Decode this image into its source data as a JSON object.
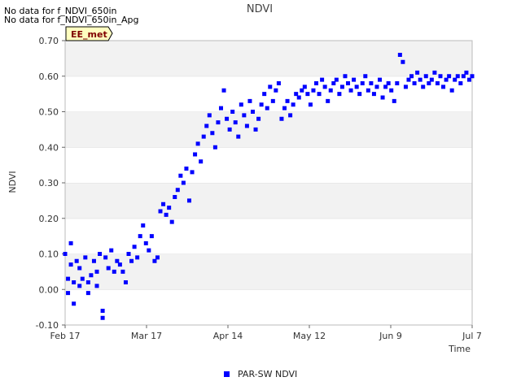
{
  "notices": [
    "No data for f_NDVI_650in",
    "No data for f_NDVI_650in_Apg"
  ],
  "site_badge": "EE_met",
  "chart_data": {
    "type": "scatter",
    "title": "NDVI",
    "xlabel": "Time",
    "ylabel": "NDVI",
    "ylim": [
      -0.1,
      0.7
    ],
    "yticks": [
      "-0.10",
      "0.00",
      "0.10",
      "0.20",
      "0.30",
      "0.40",
      "0.50",
      "0.60",
      "0.70"
    ],
    "xlim": [
      "2024-02-17",
      "2024-07-07"
    ],
    "xticks": [
      "Feb 17",
      "Mar 17",
      "Apr 14",
      "May 12",
      "Jun 9",
      "Jul 7"
    ],
    "grid": "horizontal bands",
    "legend": "bottom-center",
    "series": [
      {
        "name": "PAR-SW NDVI",
        "color": "#0000ff",
        "points": [
          [
            "2024-02-17",
            0.1
          ],
          [
            "2024-02-18",
            0.03
          ],
          [
            "2024-02-18",
            -0.01
          ],
          [
            "2024-02-19",
            0.13
          ],
          [
            "2024-02-19",
            0.07
          ],
          [
            "2024-02-20",
            0.02
          ],
          [
            "2024-02-20",
            -0.04
          ],
          [
            "2024-02-21",
            0.08
          ],
          [
            "2024-02-22",
            0.01
          ],
          [
            "2024-02-22",
            0.06
          ],
          [
            "2024-02-23",
            0.03
          ],
          [
            "2024-02-24",
            0.09
          ],
          [
            "2024-02-25",
            0.02
          ],
          [
            "2024-02-25",
            -0.01
          ],
          [
            "2024-02-26",
            0.04
          ],
          [
            "2024-02-27",
            0.08
          ],
          [
            "2024-02-28",
            0.01
          ],
          [
            "2024-02-28",
            0.05
          ],
          [
            "2024-02-29",
            0.1
          ],
          [
            "2024-03-01",
            -0.06
          ],
          [
            "2024-03-01",
            -0.08
          ],
          [
            "2024-03-02",
            0.09
          ],
          [
            "2024-03-03",
            0.06
          ],
          [
            "2024-03-04",
            0.11
          ],
          [
            "2024-03-05",
            0.05
          ],
          [
            "2024-03-06",
            0.08
          ],
          [
            "2024-03-07",
            0.07
          ],
          [
            "2024-03-08",
            0.05
          ],
          [
            "2024-03-09",
            0.02
          ],
          [
            "2024-03-10",
            0.1
          ],
          [
            "2024-03-11",
            0.08
          ],
          [
            "2024-03-12",
            0.12
          ],
          [
            "2024-03-13",
            0.09
          ],
          [
            "2024-03-14",
            0.15
          ],
          [
            "2024-03-15",
            0.18
          ],
          [
            "2024-03-16",
            0.13
          ],
          [
            "2024-03-17",
            0.11
          ],
          [
            "2024-03-18",
            0.15
          ],
          [
            "2024-03-19",
            0.08
          ],
          [
            "2024-03-20",
            0.09
          ],
          [
            "2024-03-21",
            0.22
          ],
          [
            "2024-03-22",
            0.24
          ],
          [
            "2024-03-23",
            0.21
          ],
          [
            "2024-03-24",
            0.23
          ],
          [
            "2024-03-25",
            0.19
          ],
          [
            "2024-03-26",
            0.26
          ],
          [
            "2024-03-27",
            0.28
          ],
          [
            "2024-03-28",
            0.32
          ],
          [
            "2024-03-29",
            0.3
          ],
          [
            "2024-03-30",
            0.34
          ],
          [
            "2024-03-31",
            0.25
          ],
          [
            "2024-04-01",
            0.33
          ],
          [
            "2024-04-02",
            0.38
          ],
          [
            "2024-04-03",
            0.41
          ],
          [
            "2024-04-04",
            0.36
          ],
          [
            "2024-04-05",
            0.43
          ],
          [
            "2024-04-06",
            0.46
          ],
          [
            "2024-04-07",
            0.49
          ],
          [
            "2024-04-08",
            0.44
          ],
          [
            "2024-04-09",
            0.4
          ],
          [
            "2024-04-10",
            0.47
          ],
          [
            "2024-04-11",
            0.51
          ],
          [
            "2024-04-12",
            0.56
          ],
          [
            "2024-04-13",
            0.48
          ],
          [
            "2024-04-14",
            0.45
          ],
          [
            "2024-04-15",
            0.5
          ],
          [
            "2024-04-16",
            0.47
          ],
          [
            "2024-04-17",
            0.43
          ],
          [
            "2024-04-18",
            0.52
          ],
          [
            "2024-04-19",
            0.49
          ],
          [
            "2024-04-20",
            0.46
          ],
          [
            "2024-04-21",
            0.53
          ],
          [
            "2024-04-22",
            0.5
          ],
          [
            "2024-04-23",
            0.45
          ],
          [
            "2024-04-24",
            0.48
          ],
          [
            "2024-04-25",
            0.52
          ],
          [
            "2024-04-26",
            0.55
          ],
          [
            "2024-04-27",
            0.51
          ],
          [
            "2024-04-28",
            0.57
          ],
          [
            "2024-04-29",
            0.53
          ],
          [
            "2024-04-30",
            0.56
          ],
          [
            "2024-05-01",
            0.58
          ],
          [
            "2024-05-02",
            0.48
          ],
          [
            "2024-05-03",
            0.51
          ],
          [
            "2024-05-04",
            0.53
          ],
          [
            "2024-05-05",
            0.49
          ],
          [
            "2024-05-06",
            0.52
          ],
          [
            "2024-05-07",
            0.55
          ],
          [
            "2024-05-08",
            0.54
          ],
          [
            "2024-05-09",
            0.56
          ],
          [
            "2024-05-10",
            0.57
          ],
          [
            "2024-05-11",
            0.55
          ],
          [
            "2024-05-12",
            0.52
          ],
          [
            "2024-05-13",
            0.56
          ],
          [
            "2024-05-14",
            0.58
          ],
          [
            "2024-05-15",
            0.55
          ],
          [
            "2024-05-16",
            0.59
          ],
          [
            "2024-05-17",
            0.57
          ],
          [
            "2024-05-18",
            0.53
          ],
          [
            "2024-05-19",
            0.56
          ],
          [
            "2024-05-20",
            0.58
          ],
          [
            "2024-05-21",
            0.59
          ],
          [
            "2024-05-22",
            0.55
          ],
          [
            "2024-05-23",
            0.57
          ],
          [
            "2024-05-24",
            0.6
          ],
          [
            "2024-05-25",
            0.58
          ],
          [
            "2024-05-26",
            0.56
          ],
          [
            "2024-05-27",
            0.59
          ],
          [
            "2024-05-28",
            0.57
          ],
          [
            "2024-05-29",
            0.55
          ],
          [
            "2024-05-30",
            0.58
          ],
          [
            "2024-05-31",
            0.6
          ],
          [
            "2024-06-01",
            0.56
          ],
          [
            "2024-06-02",
            0.58
          ],
          [
            "2024-06-03",
            0.55
          ],
          [
            "2024-06-04",
            0.57
          ],
          [
            "2024-06-05",
            0.59
          ],
          [
            "2024-06-06",
            0.54
          ],
          [
            "2024-06-07",
            0.57
          ],
          [
            "2024-06-08",
            0.58
          ],
          [
            "2024-06-09",
            0.56
          ],
          [
            "2024-06-10",
            0.53
          ],
          [
            "2024-06-11",
            0.58
          ],
          [
            "2024-06-12",
            0.66
          ],
          [
            "2024-06-13",
            0.64
          ],
          [
            "2024-06-14",
            0.57
          ],
          [
            "2024-06-15",
            0.59
          ],
          [
            "2024-06-16",
            0.6
          ],
          [
            "2024-06-17",
            0.58
          ],
          [
            "2024-06-18",
            0.61
          ],
          [
            "2024-06-19",
            0.59
          ],
          [
            "2024-06-20",
            0.57
          ],
          [
            "2024-06-21",
            0.6
          ],
          [
            "2024-06-22",
            0.58
          ],
          [
            "2024-06-23",
            0.59
          ],
          [
            "2024-06-24",
            0.61
          ],
          [
            "2024-06-25",
            0.58
          ],
          [
            "2024-06-26",
            0.6
          ],
          [
            "2024-06-27",
            0.57
          ],
          [
            "2024-06-28",
            0.59
          ],
          [
            "2024-06-29",
            0.6
          ],
          [
            "2024-06-30",
            0.56
          ],
          [
            "2024-07-01",
            0.59
          ],
          [
            "2024-07-02",
            0.6
          ],
          [
            "2024-07-03",
            0.58
          ],
          [
            "2024-07-04",
            0.6
          ],
          [
            "2024-07-05",
            0.61
          ],
          [
            "2024-07-06",
            0.59
          ],
          [
            "2024-07-07",
            0.6
          ]
        ]
      }
    ]
  }
}
